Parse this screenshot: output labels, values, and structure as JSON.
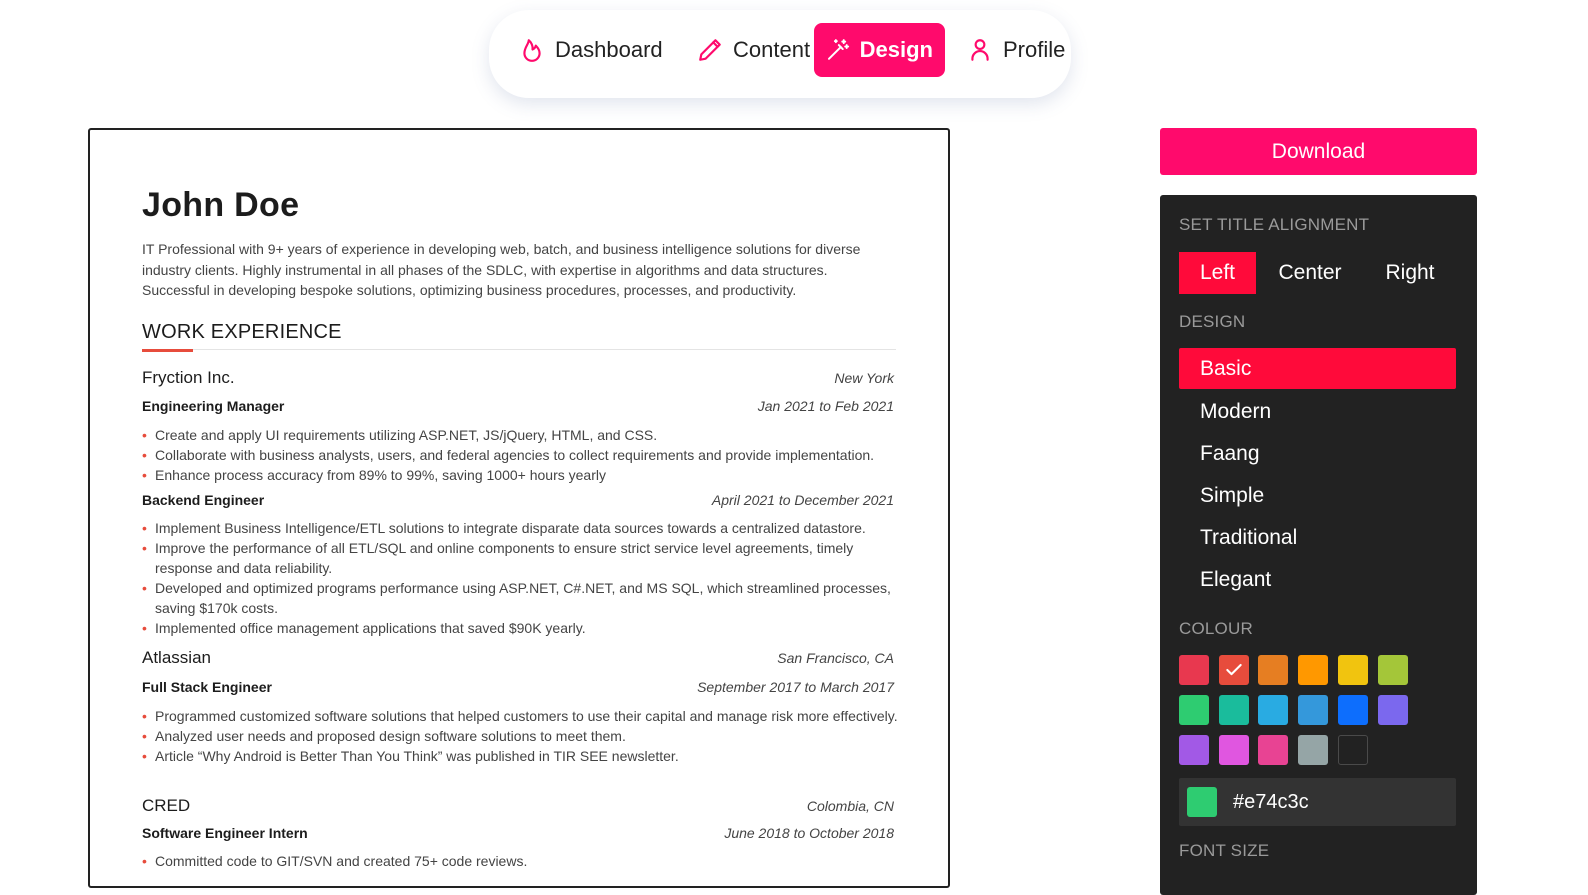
{
  "nav": {
    "items": [
      {
        "label": "Dashboard",
        "icon": "flame-icon"
      },
      {
        "label": "Content",
        "icon": "pencil-icon"
      },
      {
        "label": "Design",
        "icon": "magic-wand-icon",
        "active": true
      },
      {
        "label": "Profile",
        "icon": "user-icon"
      }
    ],
    "accent": "#ff0a6c"
  },
  "resume": {
    "name": "John Doe",
    "summary": "IT Professional with 9+ years of experience in developing web, batch, and business intelligence solutions for diverse industry clients. Highly instrumental in all phases of the SDLC, with expertise in algorithms and data structures. Successful in developing bespoke solutions, optimizing business procedures, processes, and productivity.",
    "section_title": "WORK EXPERIENCE",
    "accent": "#e74c3c",
    "jobs": [
      {
        "company": "Fryction Inc.",
        "location": "New York",
        "roles": [
          {
            "title": "Engineering Manager",
            "dates": "Jan 2021 to Feb 2021",
            "bullets": [
              "Create and apply UI requirements utilizing ASP.NET, JS/jQuery, HTML, and CSS.",
              "Collaborate with business analysts, users, and federal agencies to collect requirements and provide implementation.",
              "Enhance process accuracy from 89% to 99%, saving 1000+ hours yearly"
            ]
          },
          {
            "title": "Backend Engineer",
            "dates": "April 2021 to December 2021",
            "bullets": [
              "Implement Business Intelligence/ETL solutions to integrate disparate data sources towards a centralized datastore.",
              "Improve the performance of all ETL/SQL and online components to ensure strict service level agreements, timely response and data reliability.",
              "Developed and optimized programs performance using ASP.NET, C#.NET, and MS SQL, which streamlined processes, saving $170k costs.",
              "Implemented office management applications that saved $90K yearly."
            ]
          }
        ]
      },
      {
        "company": "Atlassian",
        "location": "San Francisco, CA",
        "roles": [
          {
            "title": "Full Stack Engineer",
            "dates": "September 2017 to March 2017",
            "bullets": [
              "Programmed customized software solutions that helped customers to use their capital and manage risk more effectively.",
              "Analyzed user needs and proposed design software solutions to meet them.",
              "Article “Why Android is Better Than You Think” was published in TIR SEE newsletter."
            ]
          }
        ]
      },
      {
        "company": "CRED",
        "location": "Colombia, CN",
        "roles": [
          {
            "title": "Software Engineer Intern",
            "dates": "June 2018 to October 2018",
            "bullets": [
              "Committed code to GIT/SVN and created 75+ code reviews."
            ]
          }
        ]
      }
    ]
  },
  "panel": {
    "download_label": "Download",
    "alignment_label": "SET TITLE ALIGNMENT",
    "alignments": [
      "Left",
      "Center",
      "Right"
    ],
    "alignment_selected": "Left",
    "design_label": "DESIGN",
    "designs": [
      "Basic",
      "Modern",
      "Faang",
      "Simple",
      "Traditional",
      "Elegant"
    ],
    "design_selected": "Basic",
    "colour_label": "COLOUR",
    "colours": [
      "#e8384f",
      "#e74c3c",
      "#e67e22",
      "#ff9800",
      "#f1c40f",
      "#a4c639",
      "#2ecc71",
      "#1abc9c",
      "#29abe2",
      "#3498db",
      "#0d6efd",
      "#7b68ee",
      "#a259e6",
      "#e056e0",
      "#e84393",
      "#95a5a6",
      "#222222"
    ],
    "colour_selected": "#e74c3c",
    "hex_value": "#e74c3c",
    "hex_chip_colour": "#2ecc71",
    "font_size_label": "FONT SIZE",
    "highlight": "#ff0a3a"
  }
}
